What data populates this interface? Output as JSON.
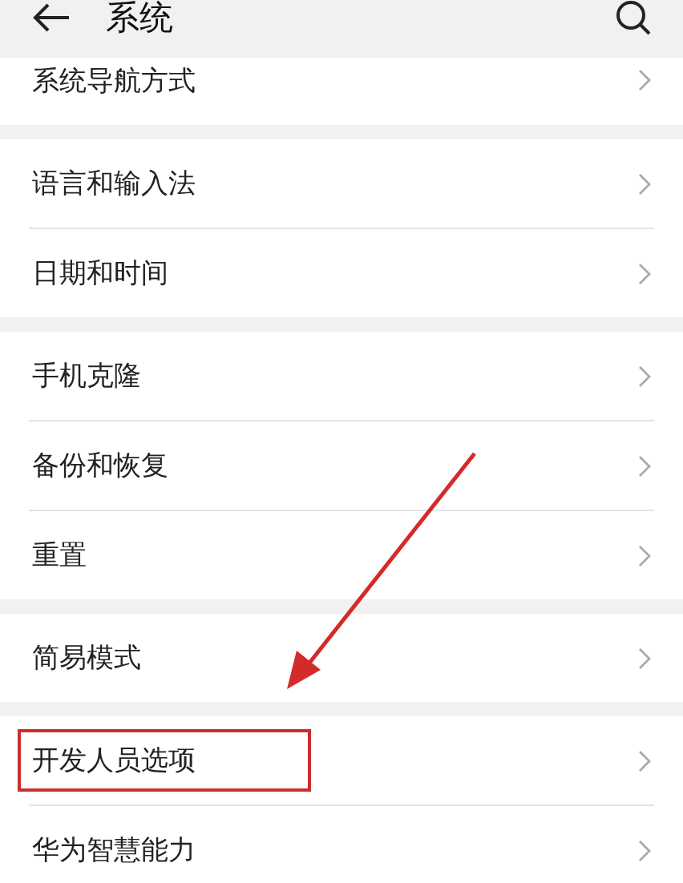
{
  "header": {
    "title": "系统"
  },
  "groups": [
    {
      "rows": [
        {
          "label": "系统导航方式",
          "highlighted": false
        }
      ]
    },
    {
      "rows": [
        {
          "label": "语言和输入法",
          "highlighted": false
        },
        {
          "label": "日期和时间",
          "highlighted": false
        }
      ]
    },
    {
      "rows": [
        {
          "label": "手机克隆",
          "highlighted": false
        },
        {
          "label": "备份和恢复",
          "highlighted": false
        },
        {
          "label": "重置",
          "highlighted": false
        }
      ]
    },
    {
      "rows": [
        {
          "label": "简易模式",
          "highlighted": false
        }
      ]
    },
    {
      "rows": [
        {
          "label": "开发人员选项",
          "highlighted": true
        },
        {
          "label": "华为智慧能力",
          "highlighted": false
        }
      ]
    }
  ]
}
